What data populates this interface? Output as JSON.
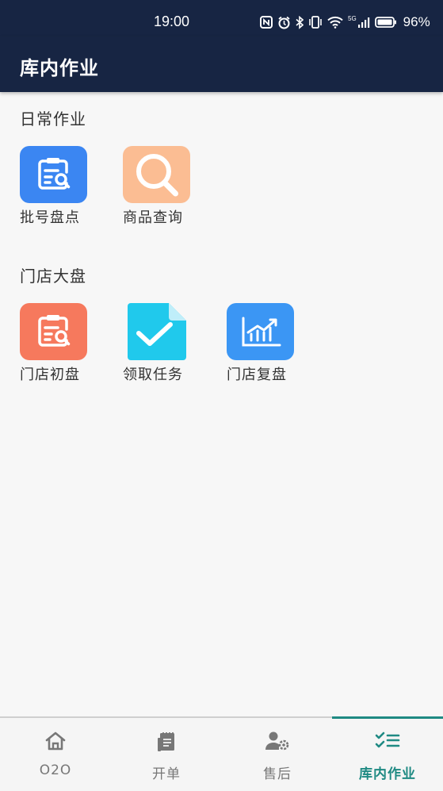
{
  "status_bar": {
    "time": "19:00",
    "network": "5G",
    "battery": "96%",
    "icons": [
      "nfc-icon",
      "alarm-icon",
      "bluetooth-icon",
      "vibrate-icon",
      "wifi-icon",
      "signal-icon",
      "battery-icon"
    ]
  },
  "app_bar": {
    "title": "库内作业"
  },
  "sections": [
    {
      "title": "日常作业",
      "tiles": [
        {
          "label": "批号盘点",
          "icon": "clipboard-search-icon",
          "color": "#3b86f2"
        },
        {
          "label": "商品查询",
          "icon": "magnifier-icon",
          "color": "#fbbd93"
        }
      ]
    },
    {
      "title": "门店大盘",
      "tiles": [
        {
          "label": "门店初盘",
          "icon": "clipboard-search-icon",
          "color": "#f6795d"
        },
        {
          "label": "领取任务",
          "icon": "document-check-icon",
          "color": "#20c9ec"
        },
        {
          "label": "门店复盘",
          "icon": "chart-trend-icon",
          "color": "#3b96f4"
        }
      ]
    }
  ],
  "bottom_nav": {
    "items": [
      {
        "label": "O2O",
        "icon": "home-icon"
      },
      {
        "label": "开单",
        "icon": "document-icon"
      },
      {
        "label": "售后",
        "icon": "user-settings-icon"
      },
      {
        "label": "库内作业",
        "icon": "checklist-icon"
      }
    ],
    "active_index": 3,
    "active_color": "#1f8a83"
  }
}
